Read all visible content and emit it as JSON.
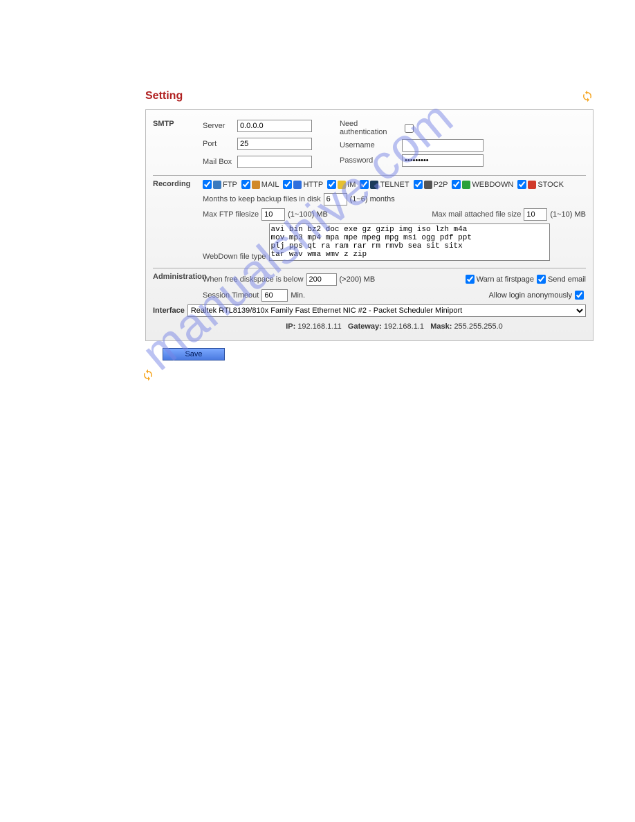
{
  "title": "Setting",
  "watermark": "manualshive.com",
  "smtp": {
    "section_label": "SMTP",
    "server_label": "Server",
    "server_value": "0.0.0.0",
    "port_label": "Port",
    "port_value": "25",
    "mailbox_label": "Mail Box",
    "mailbox_value": "",
    "need_auth_label": "Need authentication",
    "need_auth_checked": false,
    "username_label": "Username",
    "username_value": "",
    "password_label": "Password",
    "password_value": "•••••••••"
  },
  "recording": {
    "section_label": "Recording",
    "protocols": [
      {
        "name": "FTP",
        "color": "#3a7abf"
      },
      {
        "name": "MAIL",
        "color": "#d18a2a"
      },
      {
        "name": "HTTP",
        "color": "#2f6fdd"
      },
      {
        "name": "IM",
        "color": "#e6c030"
      },
      {
        "name": "TELNET",
        "color": "#1a3a5a"
      },
      {
        "name": "P2P",
        "color": "#555"
      },
      {
        "name": "WEBDOWN",
        "color": "#2aa13a"
      },
      {
        "name": "STOCK",
        "color": "#d03a2a"
      }
    ],
    "months_label": "Months to keep backup files in disk",
    "months_value": "6",
    "months_range": "(1~6) months",
    "max_ftp_label": "Max FTP filesize",
    "max_ftp_value": "10",
    "max_ftp_range": "(1~100)  MB",
    "max_mail_label": "Max mail attached file size",
    "max_mail_value": "10",
    "max_mail_range": "(1~10)  MB",
    "webdown_label": "WebDown file type",
    "webdown_value": "avi bin bz2 doc exe gz gzip img iso lzh m4a\nmov mp3 mp4 mpa mpe mpeg mpg msi ogg pdf ppt\nplj pps qt ra ram rar rm rmvb sea sit sitx\ntar wav wma wmv z zip"
  },
  "admin": {
    "section_label": "Administration",
    "diskspace_label": "When free diskspace is below",
    "diskspace_value": "200",
    "diskspace_range": "(>200) MB",
    "warn_label": "Warn at firstpage",
    "sendmail_label": "Send email",
    "session_label": "Session Timeout",
    "session_value": "60",
    "session_unit": "Min.",
    "allow_anon_label": "Allow login anonymously",
    "interface_label": "Interface",
    "interface_value": "Realtek RTL8139/810x Family Fast Ethernet NIC #2 - Packet Scheduler Miniport",
    "ip_label": "IP:",
    "ip_value": "192.168.1.11",
    "gateway_label": "Gateway:",
    "gateway_value": "192.168.1.1",
    "mask_label": "Mask:",
    "mask_value": "255.255.255.0"
  },
  "save_label": "Save"
}
